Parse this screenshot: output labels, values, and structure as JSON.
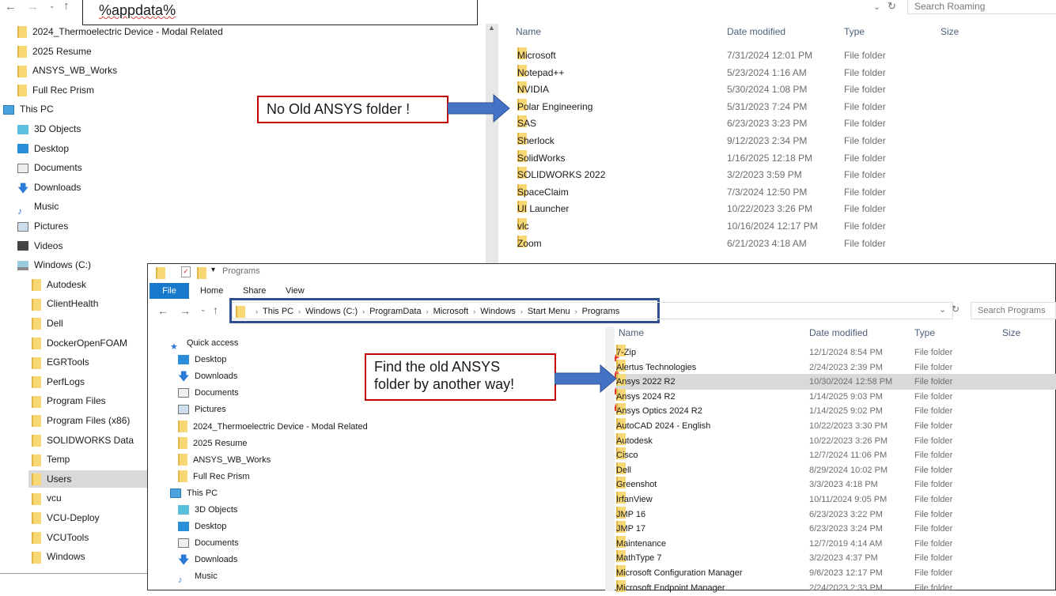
{
  "top_window": {
    "address": "%appdata%",
    "search_placeholder": "Search Roaming",
    "columns": [
      "Name",
      "Date modified",
      "Type",
      "Size"
    ],
    "nav": [
      {
        "label": "2024_Thermoelectric Device - Modal Related",
        "icon": "folder",
        "indent": 1
      },
      {
        "label": "2025 Resume",
        "icon": "folder",
        "indent": 1
      },
      {
        "label": "ANSYS_WB_Works",
        "icon": "folder",
        "indent": 1
      },
      {
        "label": "Full Rec Prism",
        "icon": "folder",
        "indent": 1
      },
      {
        "label": "This PC",
        "icon": "pc",
        "indent": 0
      },
      {
        "label": "3D Objects",
        "icon": "3d",
        "indent": 1
      },
      {
        "label": "Desktop",
        "icon": "desktop",
        "indent": 1
      },
      {
        "label": "Documents",
        "icon": "documents",
        "indent": 1
      },
      {
        "label": "Downloads",
        "icon": "download",
        "indent": 1
      },
      {
        "label": "Music",
        "icon": "music",
        "indent": 1
      },
      {
        "label": "Pictures",
        "icon": "pictures",
        "indent": 1
      },
      {
        "label": "Videos",
        "icon": "videos",
        "indent": 1
      },
      {
        "label": "Windows (C:)",
        "icon": "drive",
        "indent": 1
      },
      {
        "label": "Autodesk",
        "icon": "folder",
        "indent": 2
      },
      {
        "label": "ClientHealth",
        "icon": "folder",
        "indent": 2
      },
      {
        "label": "Dell",
        "icon": "folder",
        "indent": 2
      },
      {
        "label": "DockerOpenFOAM",
        "icon": "folder",
        "indent": 2
      },
      {
        "label": "EGRTools",
        "icon": "folder",
        "indent": 2
      },
      {
        "label": "PerfLogs",
        "icon": "folder",
        "indent": 2
      },
      {
        "label": "Program Files",
        "icon": "folder",
        "indent": 2
      },
      {
        "label": "Program Files (x86)",
        "icon": "folder",
        "indent": 2
      },
      {
        "label": "SOLIDWORKS Data",
        "icon": "folder",
        "indent": 2
      },
      {
        "label": "Temp",
        "icon": "folder",
        "indent": 2
      },
      {
        "label": "Users",
        "icon": "folder",
        "indent": 2,
        "selected": true
      },
      {
        "label": "vcu",
        "icon": "folder",
        "indent": 2
      },
      {
        "label": "VCU-Deploy",
        "icon": "folder",
        "indent": 2
      },
      {
        "label": "VCUTools",
        "icon": "folder",
        "indent": 2
      },
      {
        "label": "Windows",
        "icon": "folder",
        "indent": 2
      }
    ],
    "files": [
      [
        "Microsoft",
        "7/31/2024 12:01 PM",
        "File folder"
      ],
      [
        "Notepad++",
        "5/23/2024 1:16 AM",
        "File folder"
      ],
      [
        "NVIDIA",
        "5/30/2024 1:08 PM",
        "File folder"
      ],
      [
        "Polar Engineering",
        "5/31/2023 7:24 PM",
        "File folder"
      ],
      [
        "SAS",
        "6/23/2023 3:23 PM",
        "File folder"
      ],
      [
        "Sherlock",
        "9/12/2023 2:34 PM",
        "File folder"
      ],
      [
        "SolidWorks",
        "1/16/2025 12:18 PM",
        "File folder"
      ],
      [
        "SOLIDWORKS 2022",
        "3/2/2023 3:59 PM",
        "File folder"
      ],
      [
        "SpaceClaim",
        "7/3/2024 12:50 PM",
        "File folder"
      ],
      [
        "UI Launcher",
        "10/22/2023 3:26 PM",
        "File folder"
      ],
      [
        "vlc",
        "10/16/2024 12:17 PM",
        "File folder"
      ],
      [
        "Zoom",
        "6/21/2023 4:18 AM",
        "File folder"
      ]
    ]
  },
  "bottom_window": {
    "title": "Programs",
    "ribbon_tabs": [
      "File",
      "Home",
      "Share",
      "View"
    ],
    "breadcrumb": [
      "This PC",
      "Windows (C:)",
      "ProgramData",
      "Microsoft",
      "Windows",
      "Start Menu",
      "Programs"
    ],
    "search_placeholder": "Search Programs",
    "columns": [
      "Name",
      "Date modified",
      "Type",
      "Size"
    ],
    "nav": [
      {
        "label": "Quick access",
        "icon": "star",
        "indent": 0
      },
      {
        "label": "Desktop",
        "icon": "desktop",
        "indent": 1,
        "pinned": true
      },
      {
        "label": "Downloads",
        "icon": "download",
        "indent": 1,
        "pinned": true
      },
      {
        "label": "Documents",
        "icon": "documents",
        "indent": 1,
        "pinned": true
      },
      {
        "label": "Pictures",
        "icon": "pictures",
        "indent": 1,
        "pinned": true
      },
      {
        "label": "2024_Thermoelectric Device - Modal Related",
        "icon": "folder",
        "indent": 1
      },
      {
        "label": "2025 Resume",
        "icon": "folder",
        "indent": 1
      },
      {
        "label": "ANSYS_WB_Works",
        "icon": "folder",
        "indent": 1
      },
      {
        "label": "Full Rec Prism",
        "icon": "folder",
        "indent": 1
      },
      {
        "label": "This PC",
        "icon": "pc",
        "indent": 0
      },
      {
        "label": "3D Objects",
        "icon": "3d",
        "indent": 1
      },
      {
        "label": "Desktop",
        "icon": "desktop",
        "indent": 1
      },
      {
        "label": "Documents",
        "icon": "documents",
        "indent": 1
      },
      {
        "label": "Downloads",
        "icon": "download",
        "indent": 1
      },
      {
        "label": "Music",
        "icon": "music",
        "indent": 1
      }
    ],
    "files": [
      [
        "7-Zip",
        "12/1/2024 8:54 PM",
        "File folder"
      ],
      [
        "Alertus Technologies",
        "2/24/2023 2:39 PM",
        "File folder"
      ],
      [
        "Ansys 2022 R2",
        "10/30/2024 12:58 PM",
        "File folder",
        true
      ],
      [
        "Ansys 2024 R2",
        "1/14/2025 9:03 PM",
        "File folder"
      ],
      [
        "Ansys Optics 2024 R2",
        "1/14/2025 9:02 PM",
        "File folder"
      ],
      [
        "AutoCAD 2024 - English",
        "10/22/2023 3:30 PM",
        "File folder"
      ],
      [
        "Autodesk",
        "10/22/2023 3:26 PM",
        "File folder"
      ],
      [
        "Cisco",
        "12/7/2024 11:06 PM",
        "File folder"
      ],
      [
        "Dell",
        "8/29/2024 10:02 PM",
        "File folder"
      ],
      [
        "Greenshot",
        "3/3/2023 4:18 PM",
        "File folder"
      ],
      [
        "IrfanView",
        "10/11/2024 9:05 PM",
        "File folder"
      ],
      [
        "JMP 16",
        "6/23/2023 3:22 PM",
        "File folder"
      ],
      [
        "JMP 17",
        "6/23/2023 3:24 PM",
        "File folder"
      ],
      [
        "Maintenance",
        "12/7/2019 4:14 AM",
        "File folder"
      ],
      [
        "MathType 7",
        "3/2/2023 4:37 PM",
        "File folder"
      ],
      [
        "Microsoft Configuration Manager",
        "9/6/2023 12:17 PM",
        "File folder"
      ],
      [
        "Microsoft Endpoint Manager",
        "2/24/2023 2:33 PM",
        "File folder"
      ]
    ]
  },
  "callouts": {
    "top": "No Old ANSYS folder !",
    "bottom_line1": "Find the old ANSYS",
    "bottom_line2": "folder by another way!"
  },
  "colors": {
    "callout_border": "#c00000",
    "arrow": "#4472c4",
    "breadcrumb_box": "#2f4f8f",
    "file_tab": "#1979ca",
    "selection": "#d9d9d9"
  }
}
